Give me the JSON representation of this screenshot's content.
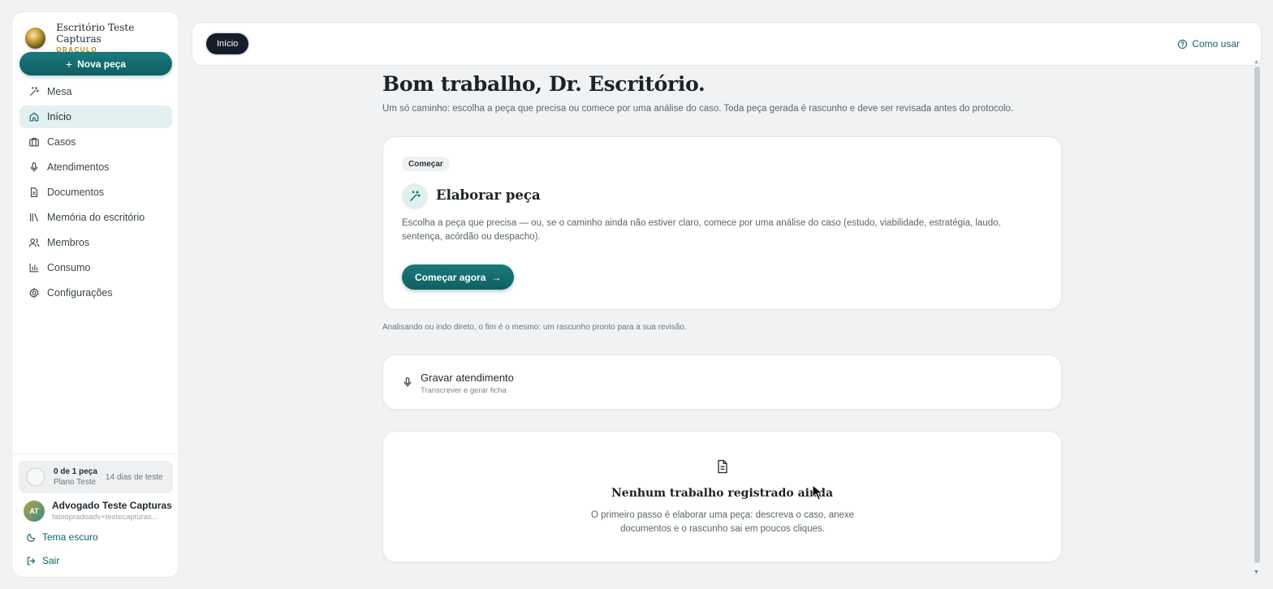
{
  "sidebar": {
    "brand_name": "Escritório Teste Capturas",
    "brand_sub": "ORÁCULO",
    "new_button": "Nova peça",
    "items": [
      {
        "label": "Mesa",
        "icon": "wand-icon"
      },
      {
        "label": "Início",
        "icon": "home-icon",
        "active": true
      },
      {
        "label": "Casos",
        "icon": "briefcase-icon"
      },
      {
        "label": "Atendimentos",
        "icon": "microphone-icon"
      },
      {
        "label": "Documentos",
        "icon": "document-icon"
      },
      {
        "label": "Memória do escritório",
        "icon": "library-icon"
      },
      {
        "label": "Membros",
        "icon": "users-icon"
      },
      {
        "label": "Consumo",
        "icon": "bar-chart-icon"
      },
      {
        "label": "Configurações",
        "icon": "gear-icon"
      }
    ],
    "plan": {
      "count": "0 de 1 peça",
      "name": "Plano Teste",
      "days": "14 dias de teste"
    },
    "user": {
      "initials": "AT",
      "name": "Advogado Teste Capturas",
      "email": "fabiopradoadv+testecapturas..."
    },
    "theme_link": "Tema escuro",
    "logout_link": "Sair"
  },
  "topbar": {
    "breadcrumb": "Início",
    "help_link": "Como usar"
  },
  "main": {
    "greeting": "Bom trabalho, Dr. Escritório.",
    "intro": "Um só caminho: escolha a peça que precisa ou comece por uma análise do caso. Toda peça gerada é rascunho e deve ser revisada antes do protocolo.",
    "start_card": {
      "badge": "Começar",
      "title": "Elaborar peça",
      "description": "Escolha a peça que precisa — ou, se o caminho ainda não estiver claro, comece por uma análise do caso (estudo, viabilidade, estratégia, laudo, sentença, acórdão ou despacho).",
      "cta": "Começar agora"
    },
    "note": "Analisando ou indo direto, o fim é o mesmo: um rascunho pronto para a sua revisão.",
    "record_card": {
      "title": "Gravar atendimento",
      "subtitle": "Transcrever e gerar ficha"
    },
    "empty_state": {
      "title": "Nenhum trabalho registrado ainda",
      "text": "O primeiro passo é elaborar uma peça: descreva o caso, anexe documentos e o rascunho sai em poucos cliques."
    }
  },
  "colors": {
    "accent": "#0f6468",
    "brand_gold": "#b08a1e",
    "dark": "#151d2b"
  }
}
